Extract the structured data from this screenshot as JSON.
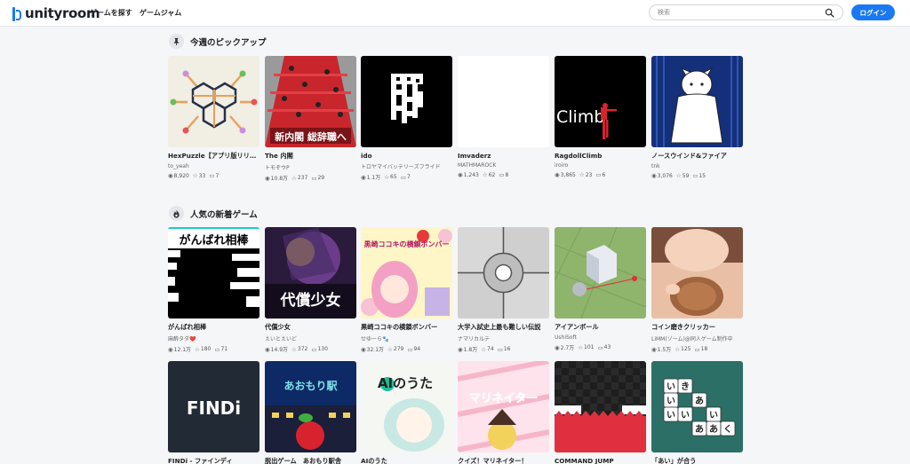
{
  "header": {
    "logo_text": "unityroom",
    "nav": [
      "ゲームを探す",
      "ゲームジャム"
    ],
    "search_placeholder": "検索",
    "login_label": "ログイン",
    "brand_color": "#1a78f2"
  },
  "sections": [
    {
      "title": "今週のピックアップ",
      "icon": "pin-icon",
      "games": [
        {
          "title": "HexPuzzle【アプリ版リリース",
          "author": "to_yeah",
          "views": "8,920",
          "stars": "33",
          "comments": "7"
        },
        {
          "title": "The 内閣",
          "author": "トモぞウP",
          "views": "10.8万",
          "stars": "237",
          "comments": "29"
        },
        {
          "title": "ido",
          "author": "トロヤマイバッテリーズフライド",
          "views": "1.1万",
          "stars": "65",
          "comments": "7"
        },
        {
          "title": "Imvaderz",
          "author": "MATHMAROCK",
          "views": "1,243",
          "stars": "62",
          "comments": "8"
        },
        {
          "title": "RagdollClimb",
          "author": "iroiro",
          "views": "3,865",
          "stars": "23",
          "comments": "6"
        },
        {
          "title": "ノースウインド&ファイア",
          "author": "tnk",
          "views": "3,076",
          "stars": "59",
          "comments": "15"
        }
      ]
    },
    {
      "title": "人気の新着ゲーム",
      "icon": "fire-icon",
      "games": [
        {
          "title": "がんばれ相棒",
          "author": "麻酔タダ❤️",
          "views": "12.1万",
          "stars": "180",
          "comments": "71"
        },
        {
          "title": "代償少女",
          "author": "えいとえいど",
          "views": "14.9万",
          "stars": "372",
          "comments": "130"
        },
        {
          "title": "黒崎ココキの横鎖ボンバー",
          "author": "せゆーら🐾",
          "views": "32.1万",
          "stars": "279",
          "comments": "94"
        },
        {
          "title": "大学入試史上最も難しい伝説",
          "author": "ナマリカルテ",
          "views": "1.8万",
          "stars": "74",
          "comments": "16"
        },
        {
          "title": "アイアンボール",
          "author": "UshiSoft",
          "views": "2.7万",
          "stars": "101",
          "comments": "43"
        },
        {
          "title": "コイン磨きクリッカー",
          "author": "LiMM(ゾーム)@同人ゲーム制作中",
          "views": "1.5万",
          "stars": "125",
          "comments": "18"
        }
      ]
    },
    {
      "games": [
        {
          "title": "FINDi - ファインディ",
          "thumb_text": "FINDi"
        },
        {
          "title": "脱出ゲーム　あおもり駅舎",
          "thumb_text": "あおもり駅"
        },
        {
          "title": "AIのうた",
          "thumb_text": "AIのうた"
        },
        {
          "title": "クイズ！マリネイター！",
          "thumb_text": "マリネイター"
        },
        {
          "title": "COMMAND JUMP"
        },
        {
          "title": "「あい」が合う",
          "thumb_text": [
            "い",
            "き",
            "い",
            "あ",
            "い",
            "い",
            "い",
            "あ",
            "あ",
            "く"
          ]
        }
      ]
    }
  ],
  "thumb_texts": {
    "the_naikaku": "新内閣 総辞職へ",
    "ragdoll": "Climb",
    "ganbare": "がんばれ相棒",
    "daisho": "代償少女",
    "kurosaki": "黒崎ココキの横鎖ボンバー"
  }
}
